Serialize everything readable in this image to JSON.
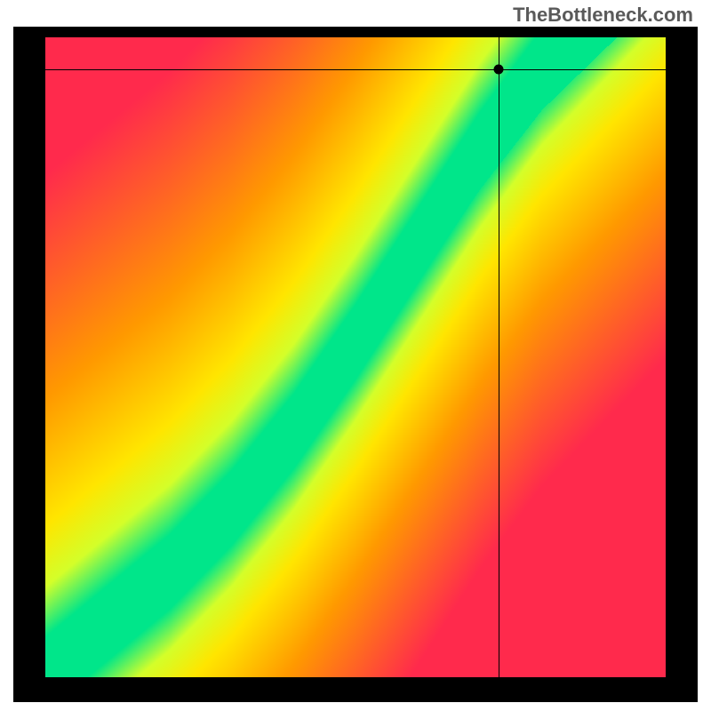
{
  "watermark": "TheBottleneck.com",
  "chart_data": {
    "type": "heatmap",
    "title": "",
    "xlabel": "",
    "ylabel": "",
    "xlim": [
      0,
      100
    ],
    "ylim": [
      0,
      100
    ],
    "colormap": {
      "low": "#ff2a4d",
      "mid_low": "#ff9a00",
      "mid": "#ffe600",
      "mid_high": "#d4ff2a",
      "optimal": "#00e68a"
    },
    "optimal_curve": [
      {
        "x": 0,
        "y": 0
      },
      {
        "x": 10,
        "y": 8
      },
      {
        "x": 20,
        "y": 16
      },
      {
        "x": 30,
        "y": 26
      },
      {
        "x": 40,
        "y": 38
      },
      {
        "x": 50,
        "y": 52
      },
      {
        "x": 60,
        "y": 67
      },
      {
        "x": 70,
        "y": 82
      },
      {
        "x": 80,
        "y": 95
      },
      {
        "x": 90,
        "y": 105
      },
      {
        "x": 100,
        "y": 115
      }
    ],
    "crosshair": {
      "x": 73,
      "y": 95
    },
    "marker": {
      "x": 73,
      "y": 95
    }
  }
}
